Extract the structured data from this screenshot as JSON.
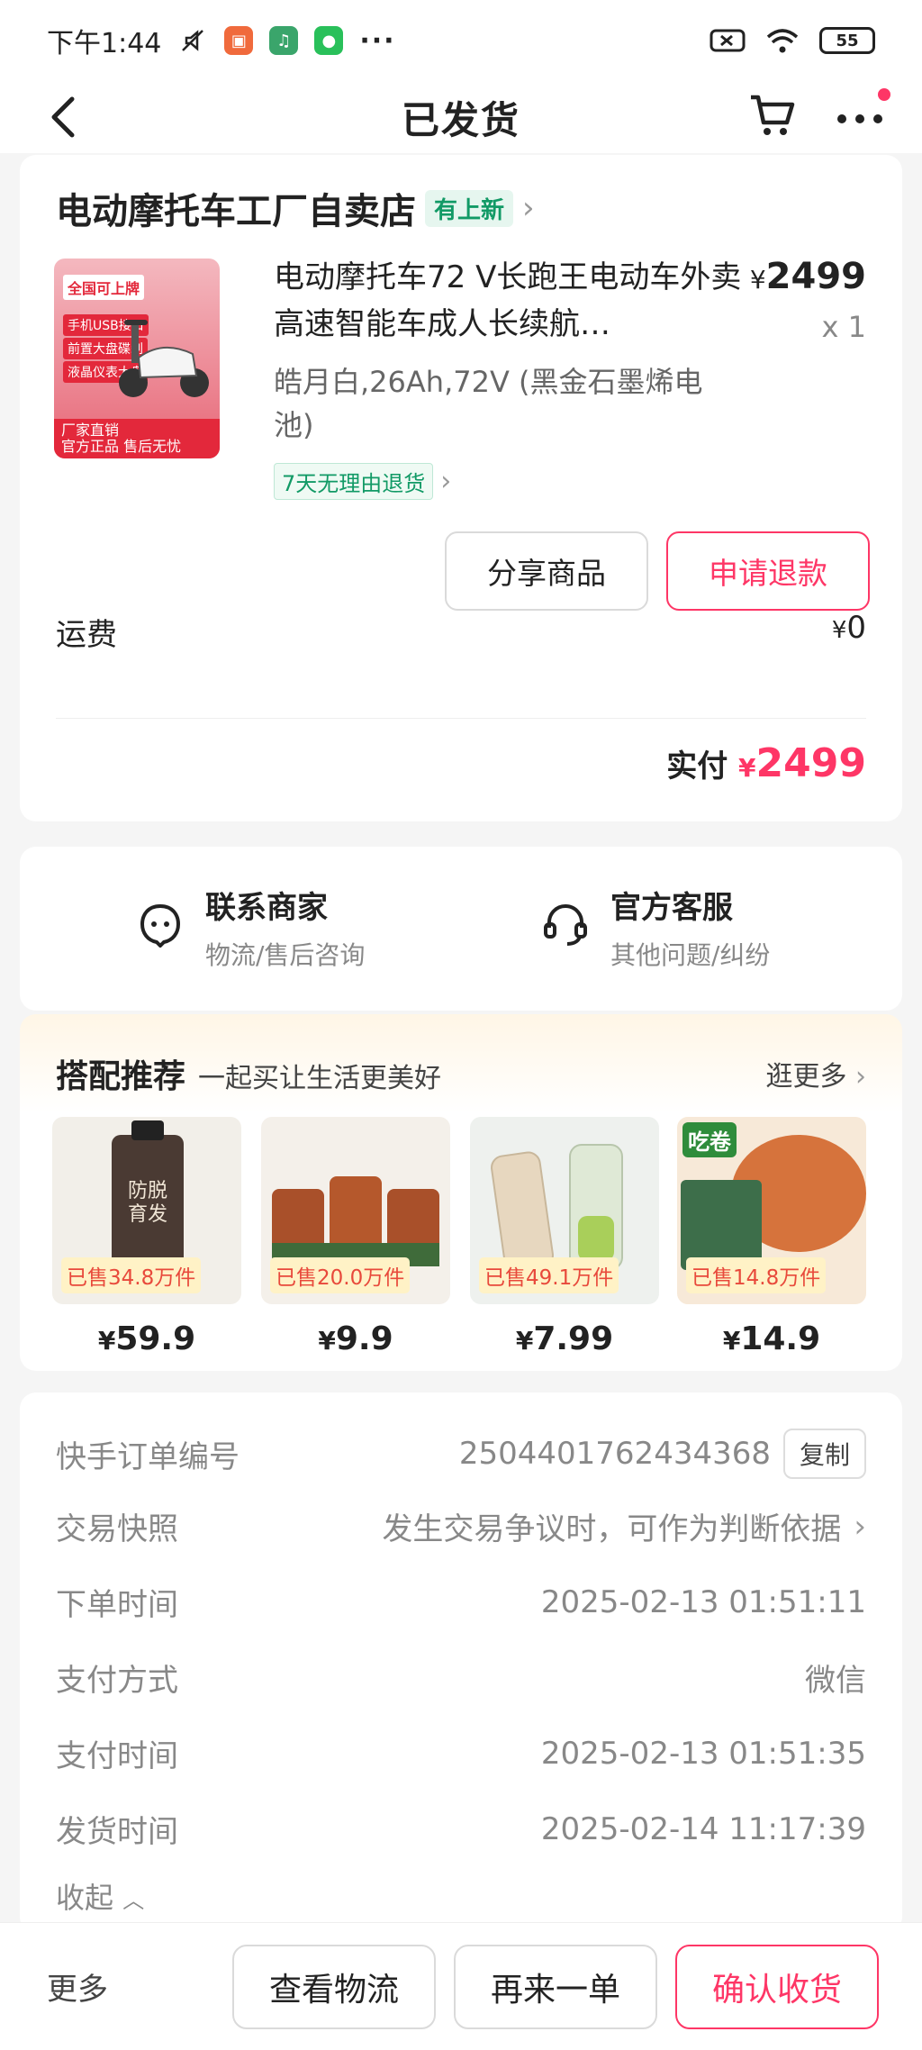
{
  "status_bar": {
    "time": "下午1:44",
    "battery": "55"
  },
  "nav": {
    "title": "已发货"
  },
  "order": {
    "shop_name": "电动摩托车工厂自卖店",
    "shop_badge": "有上新",
    "product": {
      "title": "电动摩托车72 V长跑王电动车外卖高速智能车成人长续航…",
      "spec": "皓月白,26Ah,72V (黑金石墨烯电池)",
      "price_currency": "¥",
      "price": "2499",
      "qty": "x 1",
      "refund_tag": "7天无理由退货",
      "image_texts": [
        "全国可上牌",
        "手机USB接口",
        "前置大盘碟刹",
        "液晶仪表大盘",
        "厂家直销",
        "官方正品 售后无忧"
      ]
    },
    "share_label": "分享商品",
    "refund_label": "申请退款",
    "shipping_label": "运费",
    "shipping_currency": "¥",
    "shipping_value": "0",
    "paid_label": "实付",
    "paid_currency": "¥",
    "paid_value": "2499"
  },
  "service": {
    "merchant": {
      "title": "联系商家",
      "sub": "物流/售后咨询"
    },
    "official": {
      "title": "官方客服",
      "sub": "其他问题/纠纷"
    }
  },
  "recommend": {
    "title": "搭配推荐",
    "subtitle": "一起买让生活更美好",
    "more": "逛更多",
    "items": [
      {
        "sold": "已售34.8万件",
        "currency": "¥",
        "price": "59.9",
        "img_text": "防脱育发"
      },
      {
        "sold": "已售20.0万件",
        "currency": "¥",
        "price": "9.9"
      },
      {
        "sold": "已售49.1万件",
        "currency": "¥",
        "price": "7.99"
      },
      {
        "sold": "已售14.8万件",
        "currency": "¥",
        "price": "14.9",
        "img_text": "吃卷"
      }
    ]
  },
  "info": {
    "order_no_label": "快手订单编号",
    "order_no": "2504401762434368",
    "copy_label": "复制",
    "snapshot_label": "交易快照",
    "snapshot_value": "发生交易争议时，可作为判断依据",
    "order_time_label": "下单时间",
    "order_time": "2025-02-13 01:51:11",
    "pay_method_label": "支付方式",
    "pay_method": "微信",
    "pay_time_label": "支付时间",
    "pay_time": "2025-02-13 01:51:35",
    "ship_time_label": "发货时间",
    "ship_time": "2025-02-14 11:17:39",
    "collapse_label": "收起"
  },
  "bottom": {
    "more": "更多",
    "logistics": "查看物流",
    "reorder": "再来一单",
    "confirm": "确认收货"
  },
  "colors": {
    "accent": "#fe3666",
    "green": "#129a66",
    "sold_bg": "#fff2c6"
  }
}
